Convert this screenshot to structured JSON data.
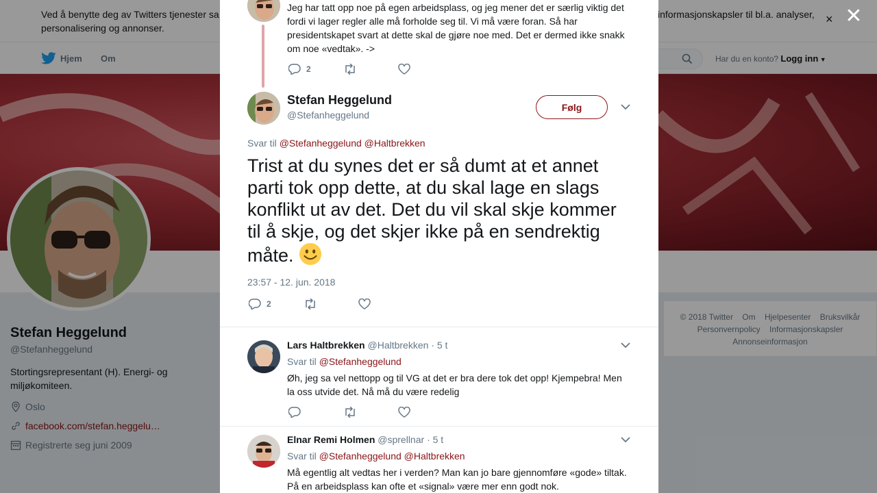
{
  "cookie": {
    "text_left": "Ved å benytte deg av Twitters tjenester sa",
    "text_left_line2": "personalisering og annonser.",
    "text_right": "informasjonskapsler til bl.a. analyser,",
    "close": "×"
  },
  "nav": {
    "home": "Hjem",
    "about": "Om",
    "account_prompt": "Har du en konto?",
    "login": "Logg inn"
  },
  "profile": {
    "name": "Stefan Heggelund",
    "handle": "@Stefanheggelund",
    "bio": "Stortingsrepresentant (H). Energi- og miljøkomiteen.",
    "location": "Oslo",
    "url": "facebook.com/stefan.heggelu…",
    "joined": "Registrerte seg juni 2009"
  },
  "footer": {
    "links": [
      "© 2018 Twitter",
      "Om",
      "Hjelpesenter",
      "Bruksvilkår",
      "Personvernpolicy",
      "Informasjonskapsler",
      "Annonseinformasjon"
    ]
  },
  "modal": {
    "close": "✕",
    "previous_tweet": {
      "text": "Jeg har tatt opp noe på egen arbeidsplass, og jeg mener det er særlig viktig det fordi vi lager regler alle må forholde seg til. Vi må være foran. Så har presidentskapet svart at dette skal de gjøre noe med. Det er dermed ikke snakk om noe «vedtak». ->",
      "reply_count": "2"
    },
    "main_tweet": {
      "name": "Stefan Heggelund",
      "handle": "@Stefanheggelund",
      "follow": "Følg",
      "reply_prefix": "Svar til",
      "reply_to_1": "@Stefanheggelund",
      "reply_to_2": "@Haltbrekken",
      "text": "Trist at du synes det er så dumt at et annet parti tok opp dette, at du skal lage en slags konflikt ut av det. Det du vil skal skje kommer til å skje, og det skjer ikke på en sendrektig måte.",
      "timestamp": "23:57 - 12. jun. 2018",
      "reply_count": "2"
    },
    "replies": [
      {
        "name": "Lars Haltbrekken",
        "handle": "@Haltbrekken",
        "time": "· 5 t",
        "reply_prefix": "Svar til",
        "reply_to_1": "@Stefanheggelund",
        "reply_to_2": "",
        "text": "Øh, jeg sa vel nettopp og til VG at det er bra dere tok det opp! Kjempebra! Men la oss utvide det. Nå må du være redelig"
      },
      {
        "name": "Elnar Remi Holmen",
        "handle": "@sprellnar",
        "time": "· 5 t",
        "reply_prefix": "Svar til",
        "reply_to_1": "@Stefanheggelund",
        "reply_to_2": "@Haltbrekken",
        "text": "Må egentlig alt vedtas her i verden? Man kan jo bare gjennomføre «gode» tiltak. På en arbeidsplass kan ofte et «signal» være mer enn godt nok."
      }
    ]
  },
  "colors": {
    "link": "#8a1418",
    "muted": "#657786",
    "twitter_blue": "#1da1f2"
  }
}
